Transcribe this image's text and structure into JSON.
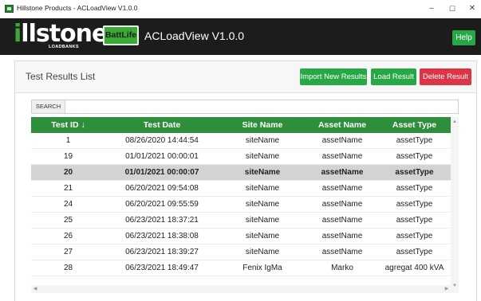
{
  "window": {
    "title": "Hillstone Products - ACLoadView V1.0.0",
    "minimize": "–",
    "maximize": "☐",
    "close": "✕"
  },
  "header": {
    "logo_i": "i",
    "logo_word": "llstone",
    "logo_sub": "LOADBANKS",
    "badge": "BattLife",
    "app_title": "ACLoadView V1.0.0",
    "help": "Help"
  },
  "panel": {
    "title": "Test Results List",
    "buttons": {
      "import": "Import New Results",
      "load": "Load Result",
      "delete": "Delete Result"
    }
  },
  "search": {
    "label": "SEARCH",
    "value": ""
  },
  "table": {
    "columns": [
      "Test ID ↓",
      "Test Date",
      "Site Name",
      "Asset Name",
      "Asset Type"
    ],
    "rows": [
      [
        "1",
        "08/26/2020 14:44:54",
        "siteName",
        "assetName",
        "assetType"
      ],
      [
        "19",
        "01/01/2021 00:00:01",
        "siteName",
        "assetName",
        "assetType"
      ],
      [
        "20",
        "01/01/2021 00:00:07",
        "siteName",
        "assetName",
        "assetType"
      ],
      [
        "21",
        "06/20/2021 09:54:08",
        "siteName",
        "assetName",
        "assetType"
      ],
      [
        "24",
        "06/20/2021 09:55:59",
        "siteName",
        "assetName",
        "assetType"
      ],
      [
        "25",
        "06/23/2021 18:37:21",
        "siteName",
        "assetName",
        "assetType"
      ],
      [
        "26",
        "06/23/2021 18:38:08",
        "siteName",
        "assetName",
        "assetType"
      ],
      [
        "27",
        "06/23/2021 18:39:27",
        "siteName",
        "assetName",
        "assetType"
      ],
      [
        "28",
        "06/23/2021 18:49:47",
        "Fenix IgMa",
        "Marko",
        "agregat 400 kVA"
      ]
    ],
    "selected_row": 2
  },
  "scroll_arrows": {
    "up": "▲",
    "down": "▼",
    "left": "◀",
    "right": "▶"
  },
  "colors": {
    "header_bg": "#1c1c1c",
    "brand_green": "#3aaa35",
    "table_header": "#2d8f3c",
    "button_green": "#28a745",
    "button_red": "#dc3545",
    "selected_row": "#d3d3d3"
  }
}
